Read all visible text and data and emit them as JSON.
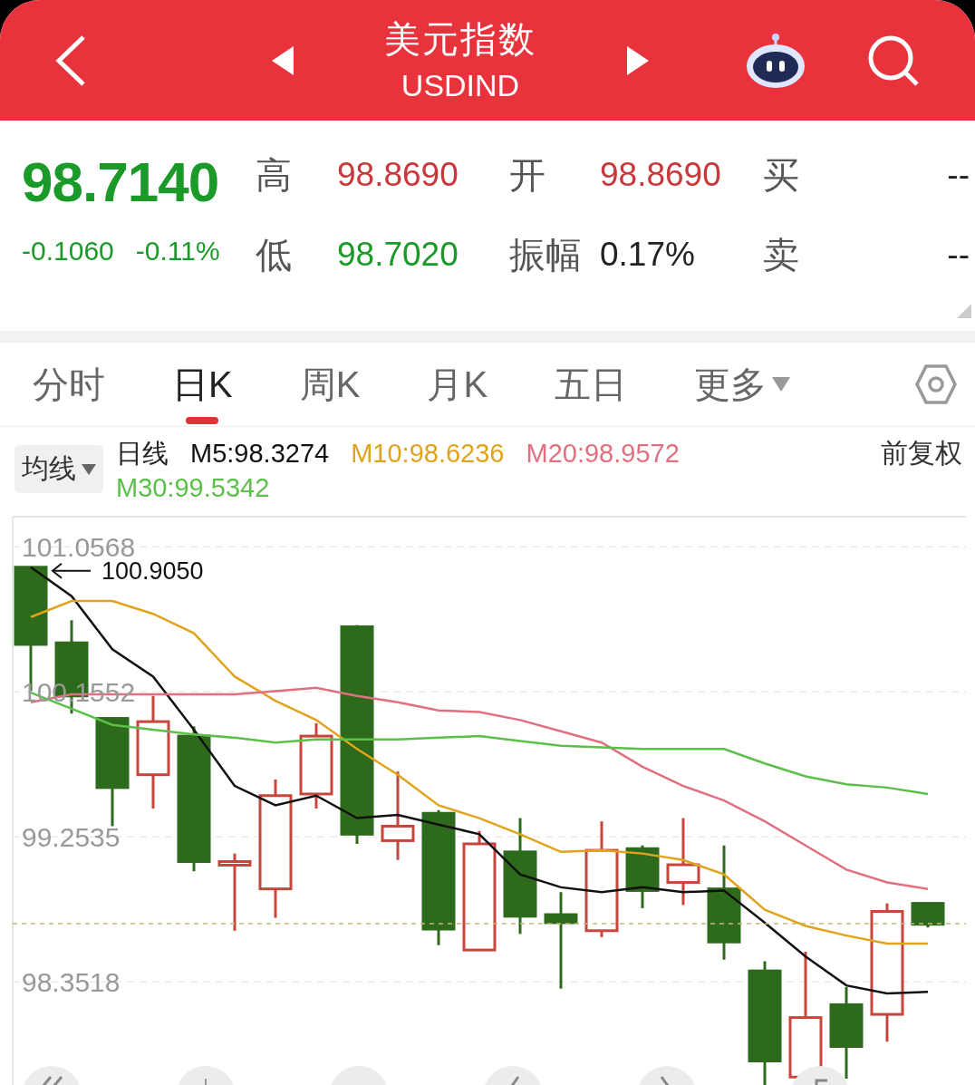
{
  "header": {
    "title": "美元指数",
    "code": "USDIND"
  },
  "quote": {
    "price": "98.7140",
    "change": "-0.1060",
    "change_pct": "-0.11%",
    "fields": [
      {
        "label": "高",
        "value": "98.8690",
        "color": "#c9383a"
      },
      {
        "label": "开",
        "value": "98.8690",
        "color": "#c9383a"
      },
      {
        "label": "买",
        "value": "--",
        "color": "#222222"
      },
      {
        "label": "低",
        "value": "98.7020",
        "color": "#1b9a29"
      },
      {
        "label": "振幅",
        "value": "0.17%",
        "color": "#222222"
      },
      {
        "label": "卖",
        "value": "--",
        "color": "#222222"
      }
    ]
  },
  "tabs": [
    {
      "label": "分时",
      "selected": false,
      "dropdown": false
    },
    {
      "label": "日K",
      "selected": true,
      "dropdown": false
    },
    {
      "label": "周K",
      "selected": false,
      "dropdown": false
    },
    {
      "label": "月K",
      "selected": false,
      "dropdown": false
    },
    {
      "label": "五日",
      "selected": false,
      "dropdown": false
    },
    {
      "label": "更多",
      "selected": false,
      "dropdown": true
    }
  ],
  "indicator": {
    "selector": "均线",
    "period": "日线",
    "adjust": "前复权",
    "legend": [
      {
        "label": "M5:98.3274",
        "color": "#111111"
      },
      {
        "label": "M10:98.6236",
        "color": "#e0a31c"
      },
      {
        "label": "M20:98.9572",
        "color": "#e07080"
      },
      {
        "label": "M30:99.5342",
        "color": "#5cbf4a"
      }
    ]
  },
  "chart_data": {
    "type": "line",
    "ylim": [
      97.66,
      101.25
    ],
    "grid": true,
    "yticks": [
      {
        "value": 101.0568,
        "label": "101.0568"
      },
      {
        "value": 100.1552,
        "label": "100.1552"
      },
      {
        "value": 99.2535,
        "label": "99.2535"
      },
      {
        "value": 98.3518,
        "label": "98.3518"
      }
    ],
    "series": [
      {
        "color": "#111111",
        "values": [
          100.93,
          100.75,
          100.42,
          100.25,
          99.92,
          99.57,
          99.45,
          99.51,
          99.37,
          99.39,
          99.33,
          99.27,
          99.02,
          98.94,
          98.91,
          98.94,
          98.91,
          98.92,
          98.72,
          98.51,
          98.33,
          98.28,
          98.29
        ]
      },
      {
        "color": "#e0a31c",
        "values": [
          100.62,
          100.72,
          100.72,
          100.64,
          100.52,
          100.25,
          100.1,
          99.98,
          99.8,
          99.64,
          99.45,
          99.37,
          99.27,
          99.16,
          99.17,
          99.15,
          99.11,
          99.02,
          98.8,
          98.7,
          98.64,
          98.59,
          98.59
        ]
      },
      {
        "color": "#e07080",
        "values": [
          100.09,
          100.14,
          100.14,
          100.14,
          100.14,
          100.14,
          100.16,
          100.18,
          100.13,
          100.09,
          100.04,
          100.03,
          99.98,
          99.91,
          99.84,
          99.69,
          99.57,
          99.48,
          99.35,
          99.2,
          99.05,
          98.97,
          98.93
        ]
      },
      {
        "color": "#5cbf4a",
        "values": [
          100.15,
          100.05,
          99.95,
          99.92,
          99.89,
          99.87,
          99.84,
          99.86,
          99.86,
          99.86,
          99.87,
          99.88,
          99.85,
          99.82,
          99.81,
          99.8,
          99.8,
          99.8,
          99.71,
          99.63,
          99.58,
          99.56,
          99.52
        ]
      }
    ],
    "ref_lines": [
      {
        "axis": "y",
        "value": 98.714,
        "color": "#c9b57a"
      }
    ],
    "annotations": [
      {
        "text": "100.9050"
      }
    ]
  }
}
